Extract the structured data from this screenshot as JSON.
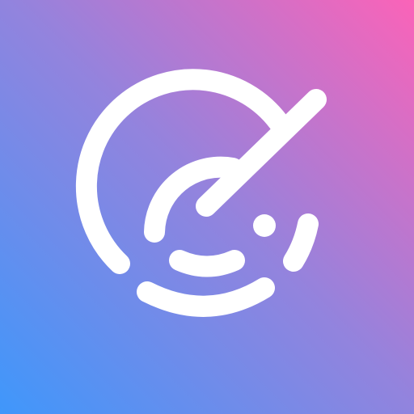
{
  "icon": {
    "name": "radar-sweep-icon",
    "gradient": {
      "start": "#3f97fb",
      "middle": "#9483dd",
      "end": "#fb63b8"
    },
    "glyph_color": "#ffffff"
  }
}
